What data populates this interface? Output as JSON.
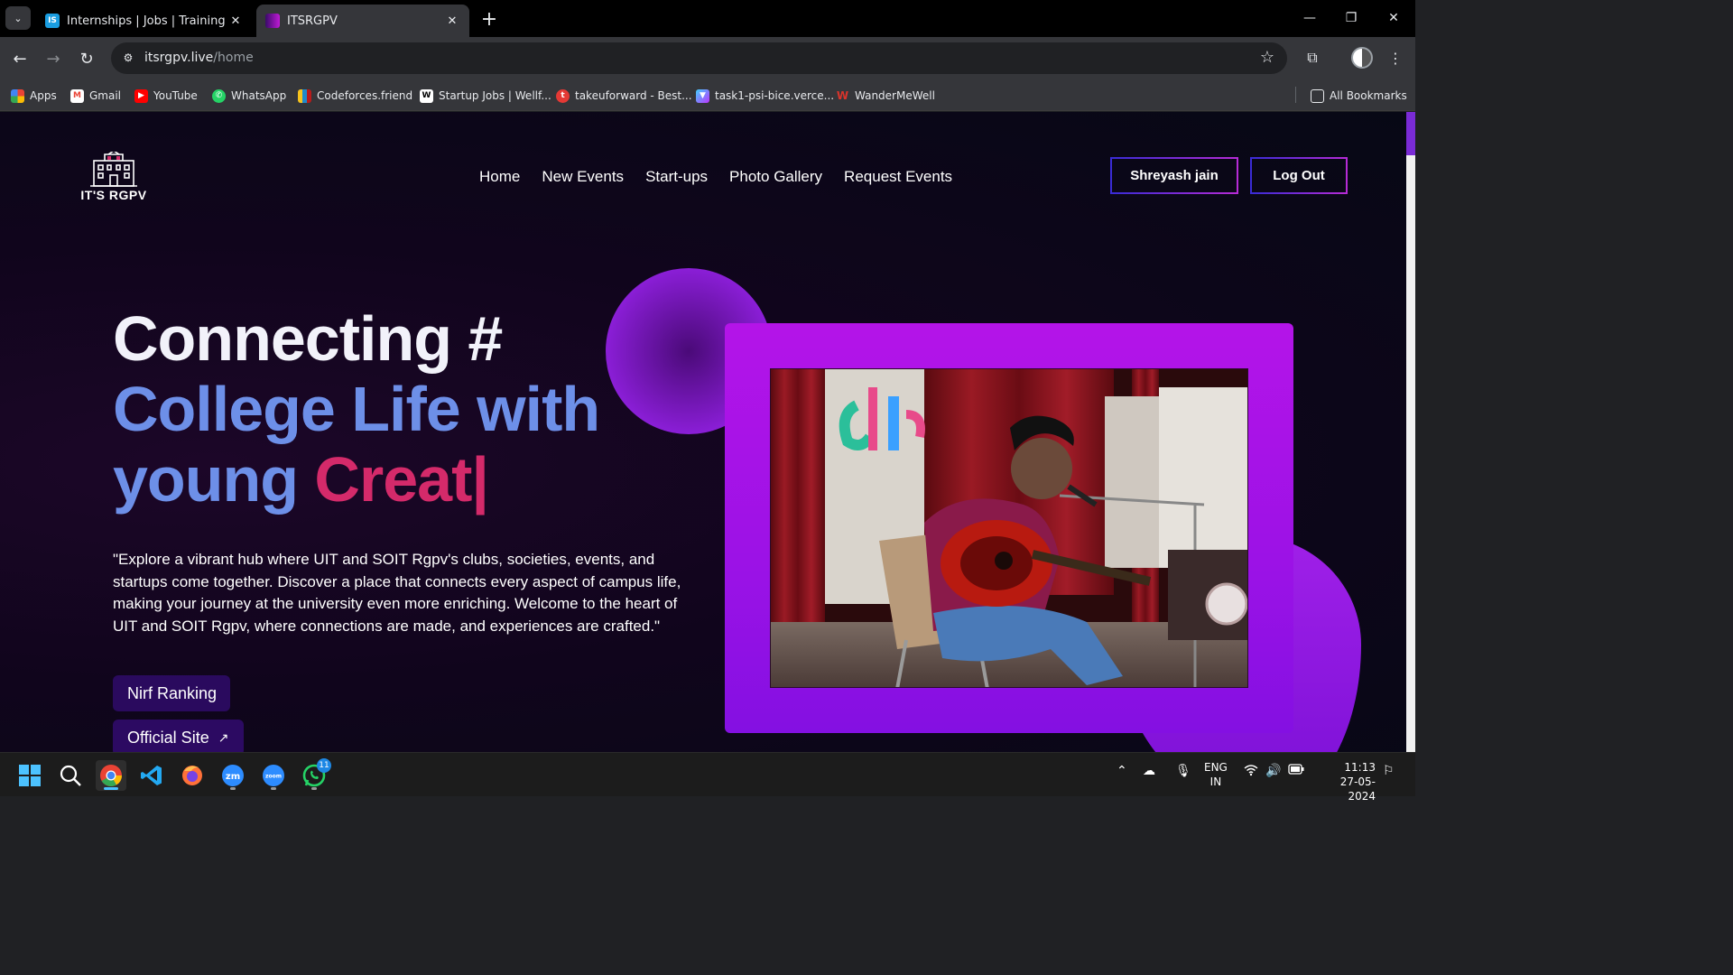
{
  "browser": {
    "tabs": [
      {
        "title": "Internships | Jobs | Trainings & I",
        "favicon": "IS",
        "favicon_color": "#1a9de0"
      },
      {
        "title": "ITSRGPV",
        "favicon": "IT",
        "favicon_color": "#6a1fb0"
      }
    ],
    "url_host": "itsrgpv.live",
    "url_path": "/home",
    "bookmarks": [
      {
        "label": "Apps",
        "icon": "apps-grid-icon",
        "color": "#e8453c"
      },
      {
        "label": "Gmail",
        "icon": "gmail-icon",
        "color": "#ea4335"
      },
      {
        "label": "YouTube",
        "icon": "youtube-icon",
        "color": "#ff0000"
      },
      {
        "label": "WhatsApp",
        "icon": "whatsapp-icon",
        "color": "#25d366"
      },
      {
        "label": "Codeforces.friend",
        "icon": "codeforces-icon",
        "color": "#1f8acb"
      },
      {
        "label": "Startup Jobs | Wellf...",
        "icon": "wellfound-icon",
        "color": "#ffffff"
      },
      {
        "label": "takeuforward - Best...",
        "icon": "takeuforward-icon",
        "color": "#e53935"
      },
      {
        "label": "task1-psi-bice.verce...",
        "icon": "vercel-vite-icon",
        "color": "#9b59f5"
      },
      {
        "label": "WanderMeWell",
        "icon": "wandermewell-icon",
        "color": "#d9342b"
      }
    ],
    "all_bookmarks": "All Bookmarks"
  },
  "site": {
    "logo_text": "IT'S RGPV",
    "nav": [
      "Home",
      "New Events",
      "Start-ups",
      "Photo Gallery",
      "Request Events"
    ],
    "user_button": "Shreyash jain",
    "logout_button": "Log Out",
    "headline_line1": "Connecting #",
    "headline_line2": "College Life with",
    "headline_line3": "young",
    "typed_text": "Creat|",
    "description": "\"Explore a vibrant hub where UIT and SOIT Rgpv's clubs, societies, events, and startups come together. Discover a place that connects every aspect of campus life, making your journey at the university even more enriching. Welcome to the heart of UIT and SOIT Rgpv, where connections are made, and experiences are crafted.\"",
    "nirf_button": "Nirf Ranking",
    "official_button": "Official Site",
    "official_arrow": "↗",
    "colors": {
      "accent_blue": "#6d8fe8",
      "accent_pink": "#d42a6a",
      "frame_purple": "#a414e8"
    }
  },
  "taskbar": {
    "apps": [
      {
        "name": "start-icon"
      },
      {
        "name": "search-icon"
      },
      {
        "name": "chrome-icon"
      },
      {
        "name": "vscode-icon"
      },
      {
        "name": "firefox-icon"
      },
      {
        "name": "zoom-workplace-icon"
      },
      {
        "name": "zoom-icon"
      },
      {
        "name": "whatsapp-icon"
      }
    ],
    "whatsapp_badge": "11",
    "language_line1": "ENG",
    "language_line2": "IN",
    "time": "11:13",
    "date": "27-05-2024"
  }
}
